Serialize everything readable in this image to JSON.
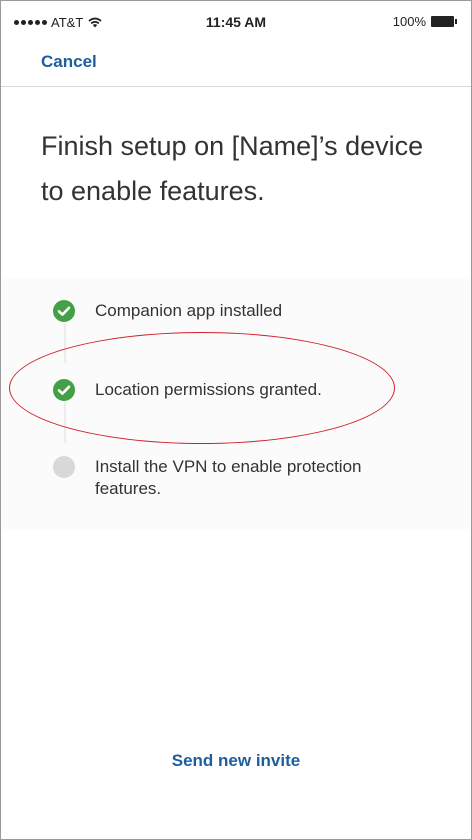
{
  "status_bar": {
    "carrier": "AT&T",
    "time": "11:45 AM",
    "battery": "100%"
  },
  "nav": {
    "cancel_label": "Cancel"
  },
  "title": "Finish setup on [Name]’s device to enable features.",
  "steps": [
    {
      "label": "Companion app installed",
      "status": "complete"
    },
    {
      "label": "Location permissions granted.",
      "status": "complete"
    },
    {
      "label": "Install the VPN to enable protection features.",
      "status": "pending"
    }
  ],
  "footer": {
    "send_invite_label": "Send new invite"
  },
  "colors": {
    "accent": "#1e5e9c",
    "complete": "#43a047",
    "pending": "#d8d8d8",
    "annotation": "#d0212b"
  },
  "icons": {
    "complete": "check-circle-icon",
    "pending": "empty-circle-icon"
  }
}
